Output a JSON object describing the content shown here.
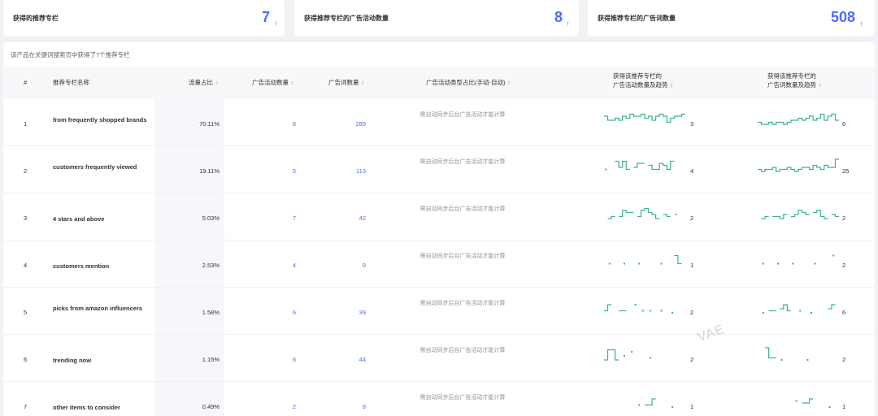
{
  "stats": [
    {
      "label": "获得的推荐专栏",
      "value": "7",
      "arrow": "↑"
    },
    {
      "label": "获得推荐专栏的广告活动数量",
      "value": "8",
      "arrow": "↑"
    },
    {
      "label": "获得推荐专栏的广告词数量",
      "value": "508",
      "arrow": "↑"
    }
  ],
  "note": "该产品在关键词搜索页中获得了7个推荐专栏",
  "columns": {
    "index": "#",
    "name": "推荐专栏名称",
    "traffic_share": "流量占比",
    "campaign_count": "广告活动数量",
    "keyword_count": "广告词数量",
    "campaign_type_share": "广告活动类型占比(手动-自动)",
    "campaign_trend_line1": "获得该推荐专栏的",
    "campaign_trend_line2": "广告活动数量及趋势",
    "keyword_trend_line1": "获得该推荐专栏的",
    "keyword_trend_line2": "广告词数量及趋势"
  },
  "sort_icon": "⇕",
  "type_placeholder": "需自动同步后台广告活动才能计算",
  "rows": [
    {
      "index": "1",
      "name": "from frequently shopped brands",
      "traffic_share": "70.11%",
      "campaigns": "6",
      "keywords": "289",
      "campaign_trend_value": "3",
      "keyword_trend_value": "6",
      "campaign_trend": [
        6,
        4,
        4,
        5,
        4,
        6,
        5,
        7,
        6,
        6,
        7,
        5,
        6,
        4,
        6,
        7,
        6,
        3,
        5,
        6,
        6,
        7
      ],
      "keyword_trend": [
        3,
        2,
        2,
        3,
        2,
        3,
        3,
        2,
        3,
        4,
        4,
        5,
        4,
        5,
        6,
        4,
        5,
        7,
        4,
        6,
        7,
        4
      ]
    },
    {
      "index": "2",
      "name": "customers frequently viewed",
      "traffic_share": "19.11%",
      "campaigns": "5",
      "keywords": "113",
      "campaign_trend_value": "4",
      "keyword_trend_value": "25",
      "campaign_trend": [
        3,
        null,
        null,
        7,
        4,
        7,
        3,
        null,
        4,
        6,
        6,
        null,
        5,
        3,
        3,
        6,
        5,
        3,
        7,
        null,
        null,
        null
      ],
      "keyword_trend": [
        3,
        2,
        3,
        3,
        4,
        2,
        3,
        3,
        4,
        3,
        2,
        3,
        4,
        4,
        3,
        5,
        4,
        3,
        5,
        4,
        4,
        8
      ]
    },
    {
      "index": "3",
      "name": "4 stars and above",
      "traffic_share": "5.03%",
      "campaigns": "7",
      "keywords": "42",
      "campaign_trend_value": "2",
      "keyword_trend_value": "2",
      "campaign_trend": [
        null,
        2,
        3,
        null,
        3,
        6,
        5,
        5,
        null,
        3,
        6,
        7,
        5,
        4,
        2,
        null,
        4,
        3,
        null,
        4,
        null,
        null
      ],
      "keyword_trend": [
        null,
        2,
        3,
        null,
        3,
        3,
        2,
        4,
        null,
        3,
        4,
        6,
        5,
        4,
        null,
        5,
        6,
        3,
        2,
        null,
        4,
        3
      ]
    },
    {
      "index": "4",
      "name": "customers mention",
      "traffic_share": "2.53%",
      "campaigns": "4",
      "keywords": "9",
      "campaign_trend_value": "1",
      "keyword_trend_value": "2",
      "campaign_trend": [
        null,
        3,
        null,
        null,
        null,
        3,
        null,
        null,
        null,
        3,
        null,
        null,
        null,
        null,
        null,
        3,
        null,
        null,
        null,
        7,
        3,
        null
      ],
      "keyword_trend": [
        null,
        3,
        null,
        null,
        null,
        3,
        null,
        null,
        null,
        3,
        null,
        null,
        null,
        null,
        null,
        3,
        null,
        null,
        null,
        null,
        7,
        null
      ]
    },
    {
      "index": "5",
      "name": "picks from amazon influencers",
      "traffic_share": "1.58%",
      "campaigns": "6",
      "keywords": "39",
      "campaign_trend_value": "2",
      "keyword_trend_value": "6",
      "campaign_trend": [
        3,
        6,
        null,
        null,
        3,
        3,
        null,
        null,
        6,
        null,
        3,
        null,
        3,
        null,
        null,
        3,
        null,
        null,
        2,
        null,
        null,
        null
      ],
      "keyword_trend": [
        null,
        2,
        null,
        3,
        3,
        null,
        4,
        6,
        3,
        null,
        null,
        3,
        null,
        null,
        2,
        null,
        null,
        null,
        null,
        4,
        6,
        null
      ]
    },
    {
      "index": "6",
      "name": "trending now",
      "traffic_share": "1.15%",
      "campaigns": "6",
      "keywords": "44",
      "campaign_trend_value": "2",
      "keyword_trend_value": "2",
      "campaign_trend": [
        2,
        7,
        7,
        2,
        null,
        4,
        null,
        6,
        null,
        null,
        null,
        null,
        3,
        null,
        null,
        null,
        null,
        null,
        null,
        null,
        null,
        null
      ],
      "keyword_trend": [
        null,
        null,
        8,
        3,
        3,
        null,
        2,
        null,
        null,
        null,
        null,
        null,
        null,
        2,
        null,
        null,
        null,
        null,
        null,
        null,
        null,
        null
      ]
    },
    {
      "index": "7",
      "name": "other items to consider",
      "traffic_share": "0.49%",
      "campaigns": "2",
      "keywords": "8",
      "campaign_trend_value": "1",
      "keyword_trend_value": "1",
      "campaign_trend": [
        null,
        null,
        null,
        null,
        null,
        null,
        null,
        null,
        null,
        3,
        null,
        3,
        3,
        6,
        null,
        null,
        null,
        null,
        2,
        null,
        null,
        null
      ],
      "keyword_trend": [
        null,
        null,
        null,
        null,
        null,
        null,
        null,
        null,
        null,
        null,
        5,
        null,
        4,
        4,
        6,
        null,
        null,
        null,
        null,
        2,
        null,
        null
      ]
    }
  ],
  "watermark": "VAE",
  "colors": {
    "accent": "#4f6bff",
    "spark": "#3cb38a"
  }
}
